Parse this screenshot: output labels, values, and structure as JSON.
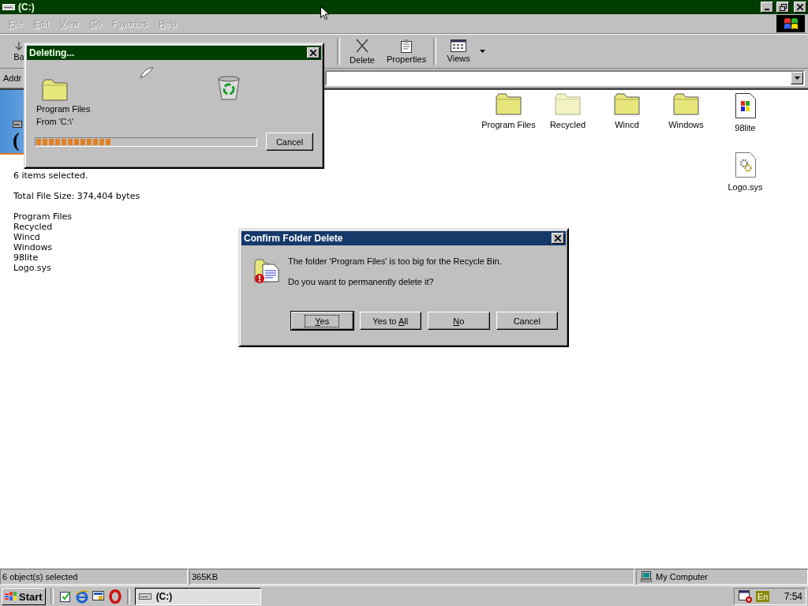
{
  "window": {
    "title": "(C:)"
  },
  "menu": [
    {
      "key": "F",
      "post": "ile",
      "disabled": true
    },
    {
      "key": "E",
      "post": "dit",
      "disabled": true
    },
    {
      "key": "V",
      "post": "iew",
      "disabled": true
    },
    {
      "key": "G",
      "post": "o",
      "disabled": true
    },
    {
      "pre": "F",
      "key": "a",
      "post": "vorites",
      "disabled": true
    },
    {
      "key": "H",
      "post": "elp",
      "disabled": true
    }
  ],
  "toolbar": [
    {
      "label": "Ba",
      "kind": "back"
    },
    {
      "label": "Delete",
      "kind": "delete"
    },
    {
      "label": "Properties",
      "kind": "properties"
    },
    {
      "label": "Views",
      "kind": "views"
    }
  ],
  "address": {
    "label": "Addr"
  },
  "web_panel": {
    "heading": "(",
    "summary": "6 items selected.",
    "size": "Total File Size: 374,404 bytes",
    "items": [
      "Program Files",
      "Recycled",
      "Wincd",
      "Windows",
      "98lite",
      "Logo.sys"
    ]
  },
  "files": [
    {
      "name": "Program Files",
      "kind": "folder",
      "hidden": false
    },
    {
      "name": "Recycled",
      "kind": "folder",
      "hidden": true
    },
    {
      "name": "Wincd",
      "kind": "folder",
      "hidden": false
    },
    {
      "name": "Windows",
      "kind": "folder",
      "hidden": false
    },
    {
      "name": "98lite",
      "kind": "program",
      "hidden": false
    },
    {
      "name": "Logo.sys",
      "kind": "system",
      "hidden": false
    }
  ],
  "status_bar": [
    "6 object(s) selected",
    "365KB",
    "My Computer"
  ],
  "taskbar": {
    "start": "Start",
    "tasks": [
      {
        "label": "(C:)",
        "selected": true
      }
    ],
    "language": "En",
    "clock": "7:54"
  },
  "deleting_dialog": {
    "title": "Deleting...",
    "file": "Program Files",
    "from": "From 'C:\\'",
    "level": 0.34,
    "button": "Cancel"
  },
  "confirm_dialog": {
    "title": "Confirm Folder Delete",
    "message": "The folder 'Program Files' is too big for the Recycle Bin.",
    "question": "Do you want to permanently delete it?",
    "buttons": [
      {
        "key": "Y",
        "post": "es",
        "default": true
      },
      {
        "pre": "Yes to ",
        "key": "A",
        "post": "ll",
        "default": false
      },
      {
        "key": "N",
        "post": "o",
        "default": false
      },
      {
        "pre": "Cancel",
        "default": false
      }
    ]
  }
}
